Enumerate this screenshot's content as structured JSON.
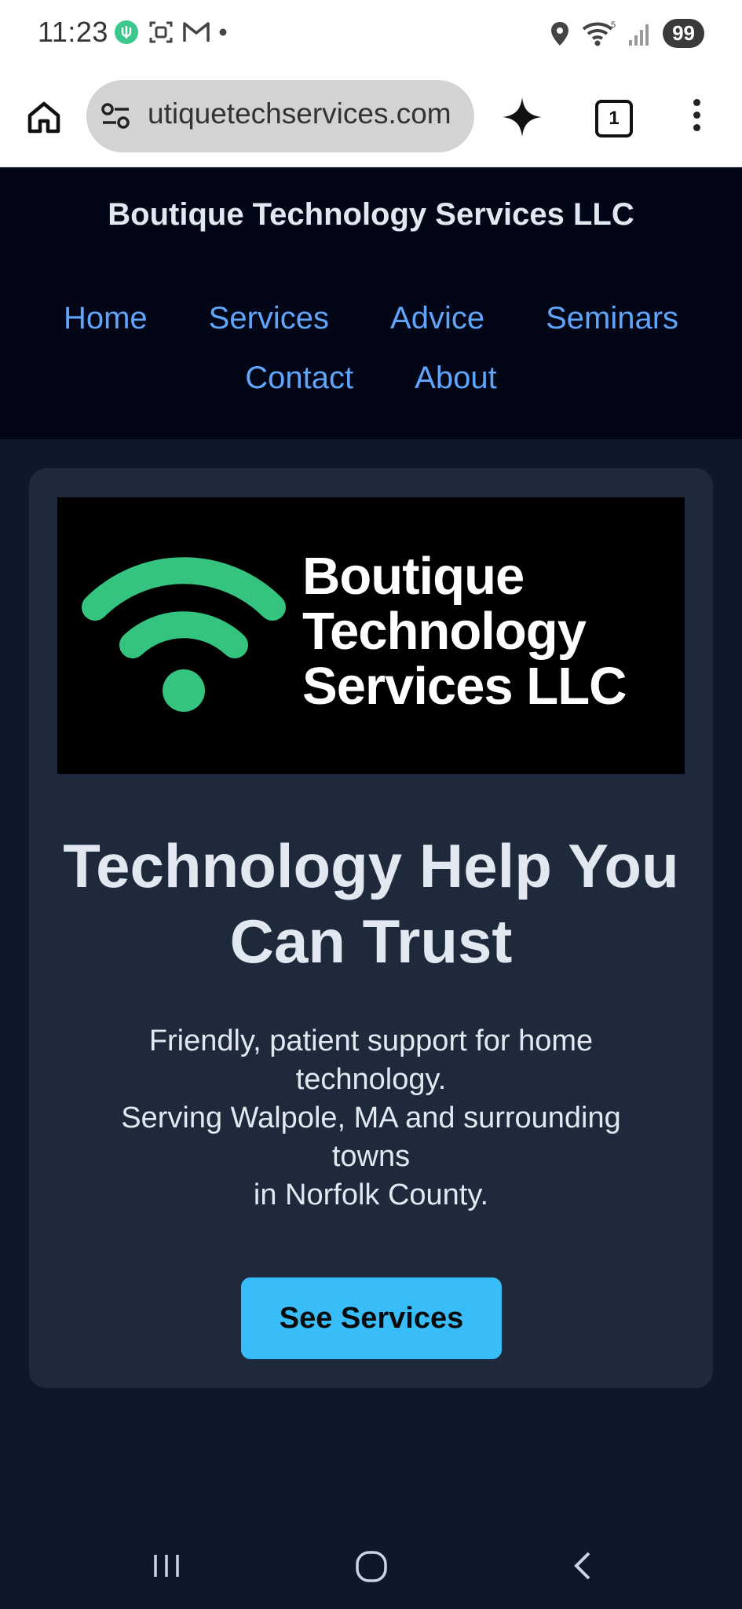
{
  "status_bar": {
    "time": "11:23",
    "battery": "99"
  },
  "browser": {
    "url": "utiquetechservices.com",
    "tab_count": "1"
  },
  "site": {
    "title": "Boutique Technology Services LLC",
    "nav_row1": [
      "Home",
      "Services",
      "Advice",
      "Seminars"
    ],
    "nav_row2": [
      "Contact",
      "About"
    ]
  },
  "hero": {
    "logo_lines": [
      "Boutique",
      "Technology",
      "Services LLC"
    ],
    "title_line1": "Technology Help You",
    "title_line2": "Can Trust",
    "text_lines": [
      "Friendly, patient support for home",
      "technology.",
      "Serving Walpole, MA and surrounding",
      "towns",
      "in Norfolk County."
    ],
    "cta_label": "See Services"
  },
  "colors": {
    "header_bg": "#020617",
    "page_bg": "#0f172a",
    "card_bg": "#1e293b",
    "nav_link": "#60a5fa",
    "cta": "#38bdf8",
    "logo_green": "#34c47f"
  }
}
